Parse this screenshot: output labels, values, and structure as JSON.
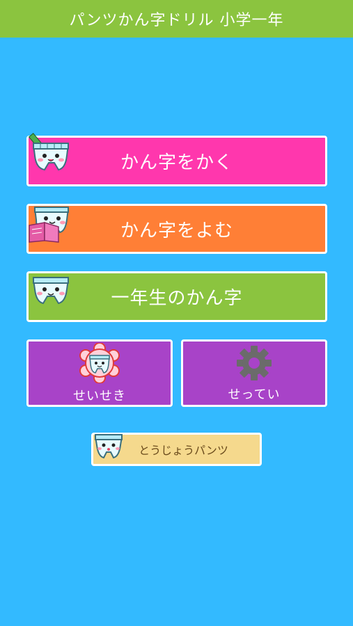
{
  "header": {
    "title": "パンツかん字ドリル 小学一年"
  },
  "menu": {
    "write_label": "かん字をかく",
    "read_label": "かん字をよむ",
    "list_label": "一年生のかん字",
    "grade_label": "せいせき",
    "settings_label": "せってい",
    "characters_label": "とうじょうパンツ"
  },
  "colors": {
    "background": "#33baff",
    "header": "#8bc43f",
    "write": "#ff37ad",
    "read": "#ff7f36",
    "list": "#8bc43f",
    "purple": "#a843c8",
    "characters": "#f5d98d"
  },
  "icons": {
    "write": "pants-mascot-pencil-icon",
    "read": "pants-mascot-book-icon",
    "list": "pants-mascot-icon",
    "grade": "flower-badge-mascot-icon",
    "settings": "gear-icon",
    "characters": "pants-mascot-icon"
  }
}
